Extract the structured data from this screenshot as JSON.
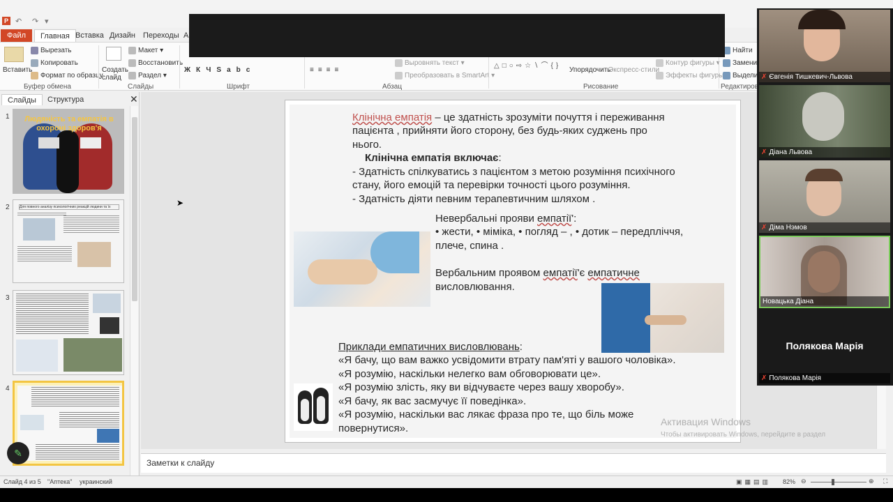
{
  "quick_access": {
    "undo": "↶",
    "redo": "↷",
    "customize": "▾"
  },
  "tabs": [
    "Файл",
    "Главная",
    "Вставка",
    "Дизайн",
    "Переходы",
    "А"
  ],
  "ribbon": {
    "paste": "Вставить",
    "cut": "Вырезать",
    "copy": "Копировать",
    "format_painter": "Формат по образцу",
    "new_slide": "Создать слайд",
    "layout": "Макет",
    "reset": "Восстановить",
    "section": "Раздел",
    "align_text": "Выровнять текст",
    "smartart": "Преобразовать в SmartArt",
    "arrange": "Упорядочить",
    "quick_styles": "Экспресс-стили",
    "shape_outline": "Контур фигуры",
    "shape_effects": "Эффекты фигуры",
    "find": "Найти",
    "replace": "Заменить",
    "select": "Выделить",
    "groups": {
      "clipboard": "Буфер обмена",
      "slides": "Слайды",
      "font": "Шрифт",
      "paragraph": "Абзац",
      "drawing": "Рисование",
      "editing": "Редактирова"
    }
  },
  "left_pane": {
    "tab_slides": "Слайды",
    "tab_outline": "Структура",
    "close": "✕",
    "thumb1_title": "Людяність та емпатія в охороні здоров'я",
    "thumb2_header": "Для повного аналізу психологічних реакцій людини та їх вираження у хворих"
  },
  "slide": {
    "clinical_empathy": "Клінічна емпатія",
    "def_rest_1": " – це здатність зрозуміти почуття і переживання",
    "def_line2": "пацієнта , прийняти його сторону, без будь-яких суджень про",
    "def_line3": "нього.",
    "includes": "Клінічна емпатія включає",
    "includes_colon": ":",
    "inc_1a": "- Здатність спілкуватись з пацієнтом з метою розуміння психічного",
    "inc_1b": "стану, його емоцій та перевірки точності цього розуміння.",
    "inc_2": "- Здатність діяти певним терапевтичним шляхом .",
    "nonverbal_a": "Невербальні прояви ",
    "nonverbal_b": "емпатії",
    "nonverbal_c": "':",
    "nonverbal_list_1": "• жести, • міміка, • погляд – , • дотик – передпліччя,",
    "nonverbal_list_2": "плече, спина .",
    "verbal_a": "Вербальним проявом ",
    "verbal_b": "емпатії",
    "verbal_c": "'є ",
    "verbal_d": "емпатичне",
    "verbal_line2": "висловлювання.",
    "examples_title": "Приклади емпатичних висловлювань",
    "examples_colon": ":",
    "ex1": "«Я бачу, що вам важко усвідомити втрату пам'яті у вашого чоловіка».",
    "ex2": "«Я розумію, наскільки нелегко вам обговорювати це».",
    "ex3": "«Я розумію злість, яку ви відчуваєте через вашу хворобу».",
    "ex4": "«Я бачу, як вас засмучує її поведінка».",
    "ex5": " «Я розумію, наскільки вас лякає фраза про те, що біль може",
    "ex6": "повернутися»."
  },
  "watermark": {
    "title": "Активация Windows",
    "line": "Чтобы активировать Windows, перейдите в раздел"
  },
  "notes_placeholder": "Заметки к слайду",
  "status": {
    "slide_of": "Слайд 4 из 5",
    "theme": "\"Аптека\"",
    "language": "украинский",
    "zoom": "82%"
  },
  "participants": [
    {
      "name": "Євгенія Тишкевич-Львова",
      "bg": "#8a7a6a"
    },
    {
      "name": "Діана Львова",
      "bg": "#5c6b4e"
    },
    {
      "name": "Діма Нэмов",
      "bg": "#9a9a8c"
    },
    {
      "name": "Новацька Діана",
      "bg": "#b8b0aa"
    },
    {
      "name": "Полякова Марія",
      "bg": "#1a1a1a",
      "big_label": "Полякова Марія"
    }
  ],
  "thumb_numbers": [
    "1",
    "2",
    "3",
    "4"
  ]
}
